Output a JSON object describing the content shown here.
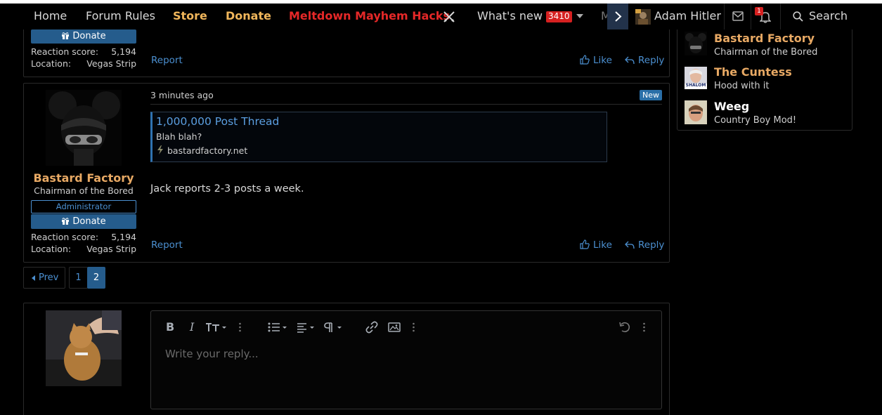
{
  "nav": {
    "home": "Home",
    "forum_rules": "Forum Rules",
    "store": "Store",
    "donate": "Donate",
    "meltdown": "Meltdown Mayhem Hacks",
    "whats_new": "What's new",
    "whats_new_count": "3410",
    "more": "M",
    "username": "Adam Hitler",
    "alerts_count": "1",
    "search": "Search"
  },
  "post_top": {
    "donate_label": "Donate",
    "reaction_label": "Reaction score:",
    "reaction_value": "5,194",
    "location_label": "Location:",
    "location_value": "Vegas Strip",
    "report": "Report",
    "like": "Like",
    "reply": "Reply"
  },
  "post_main": {
    "time": "3 minutes ago",
    "new_badge": "New",
    "author_name": "Bastard Factory",
    "author_title": "Chairman of the Bored",
    "role_badge": "Administrator",
    "donate_label": "Donate",
    "reaction_label": "Reaction score:",
    "reaction_value": "5,194",
    "location_label": "Location:",
    "location_value": "Vegas Strip",
    "embed_title": "1,000,000 Post Thread",
    "embed_snippet": "Blah blah?",
    "embed_site": "bastardfactory.net",
    "body": "Jack reports 2-3 posts a week.",
    "report": "Report",
    "like": "Like",
    "reply": "Reply"
  },
  "pagination": {
    "prev": "Prev",
    "pages": [
      "1",
      "2"
    ],
    "current": "2"
  },
  "reply_editor": {
    "placeholder": "Write your reply..."
  },
  "sidebar": {
    "members": [
      {
        "name": "Bastard Factory",
        "title": "Chairman of the Bored"
      },
      {
        "name": "The Cuntess",
        "title": "Hood with it"
      },
      {
        "name": "Weeg",
        "title": "Country Boy Mod!"
      }
    ],
    "avatar2_caption": "SHALOM"
  },
  "colors": {
    "accent_blue": "#4b8fd0",
    "donate_blue": "#255c8c",
    "gold": "#f0b65b",
    "red": "#e52828",
    "author_orange": "#e8a964"
  }
}
